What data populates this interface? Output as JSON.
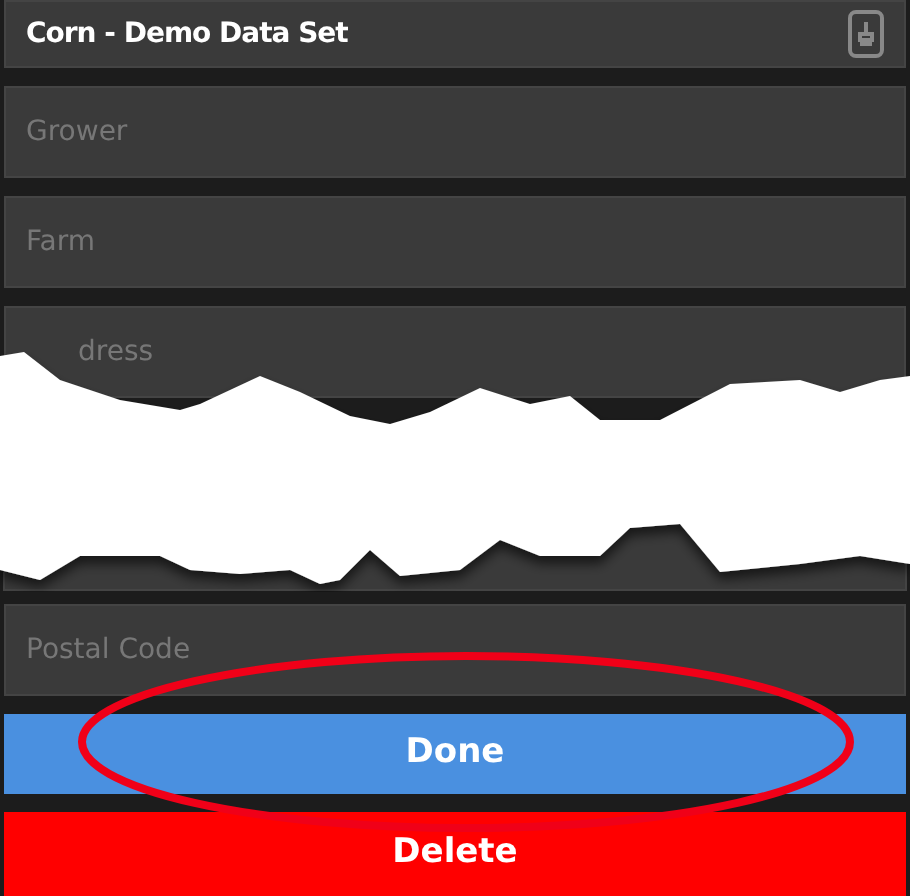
{
  "header": {
    "title": "Corn - Demo Data Set"
  },
  "fields": [
    {
      "kind": "text",
      "placeholder": "Grower"
    },
    {
      "kind": "text",
      "placeholder": "Farm"
    },
    {
      "kind": "text",
      "placeholder": "dress"
    },
    {
      "kind": "text",
      "placeholder": "Postal Code"
    }
  ],
  "buttons": [
    {
      "label": "Done",
      "kind": "primary"
    },
    {
      "label": "Delete",
      "kind": "danger"
    }
  ]
}
